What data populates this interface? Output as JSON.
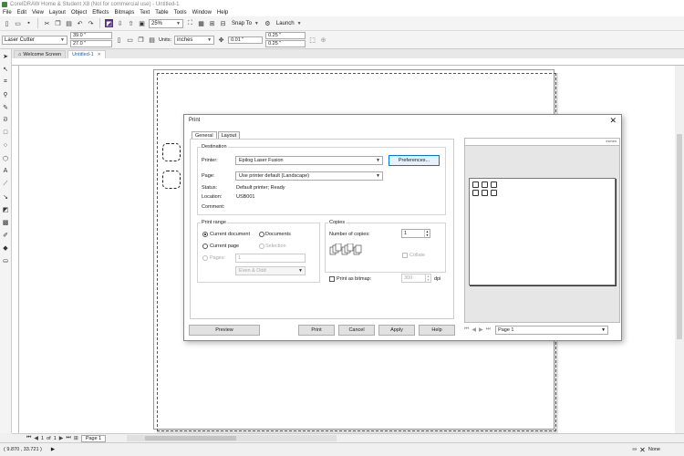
{
  "window": {
    "title": "CorelDRAW Home & Student X8 (Not for commercial use) - Untitled-1"
  },
  "menu": [
    "File",
    "Edit",
    "View",
    "Layout",
    "Object",
    "Effects",
    "Bitmaps",
    "Text",
    "Table",
    "Tools",
    "Window",
    "Help"
  ],
  "toolbar": {
    "zoom": "25%",
    "snap_to": "Snap To",
    "launch": "Launch"
  },
  "property_bar": {
    "preset": "Laser Cutter",
    "width": "39.0 \"",
    "height": "27.0 \"",
    "units_label": "Units:",
    "units": "inches",
    "nudge": "0.01 \"",
    "dup_x": "0.25 \"",
    "dup_y": "0.25 \""
  },
  "doc_tabs": [
    {
      "label": "Welcome Screen"
    },
    {
      "label": "Untitled-1"
    }
  ],
  "page_nav": {
    "page_of": "1",
    "of_label": "of",
    "total": "1",
    "page_tab": "Page 1"
  },
  "status": {
    "coords": "( 9.870 , 33.721 )",
    "fill": "None"
  },
  "dialog": {
    "title": "Print",
    "tabs": [
      "General",
      "Layout"
    ],
    "destination": {
      "legend": "Destination",
      "printer_label": "Printer:",
      "printer_value": "Epilog Laser Fusion",
      "preferences_button": "Preferences...",
      "page_label": "Page:",
      "page_value": "Use printer default (Landscape)",
      "status_label": "Status:",
      "status_value": "Default printer; Ready",
      "location_label": "Location:",
      "location_value": "USB001",
      "comment_label": "Comment:"
    },
    "print_range": {
      "legend": "Print range",
      "current_document": "Current document",
      "documents": "Documents",
      "current_page": "Current page",
      "selection": "Selection",
      "pages": "Pages:",
      "pages_value": "1",
      "even_odd": "Even & Odd"
    },
    "copies": {
      "legend": "Copies",
      "number_label": "Number of copies:",
      "number_value": "1",
      "collate": "Collate",
      "print_as_bitmap": "Print as bitmap:",
      "dpi_value": "300",
      "dpi_unit": "dpi"
    },
    "buttons": {
      "preview": "Preview",
      "print": "Print",
      "cancel": "Cancel",
      "apply": "Apply",
      "help": "Help"
    },
    "preview_ruler": "inches",
    "preview_page_select": "Page 1"
  },
  "colors": {
    "accent": "#0078d7",
    "tab_active_text": "#1a5fb4"
  }
}
